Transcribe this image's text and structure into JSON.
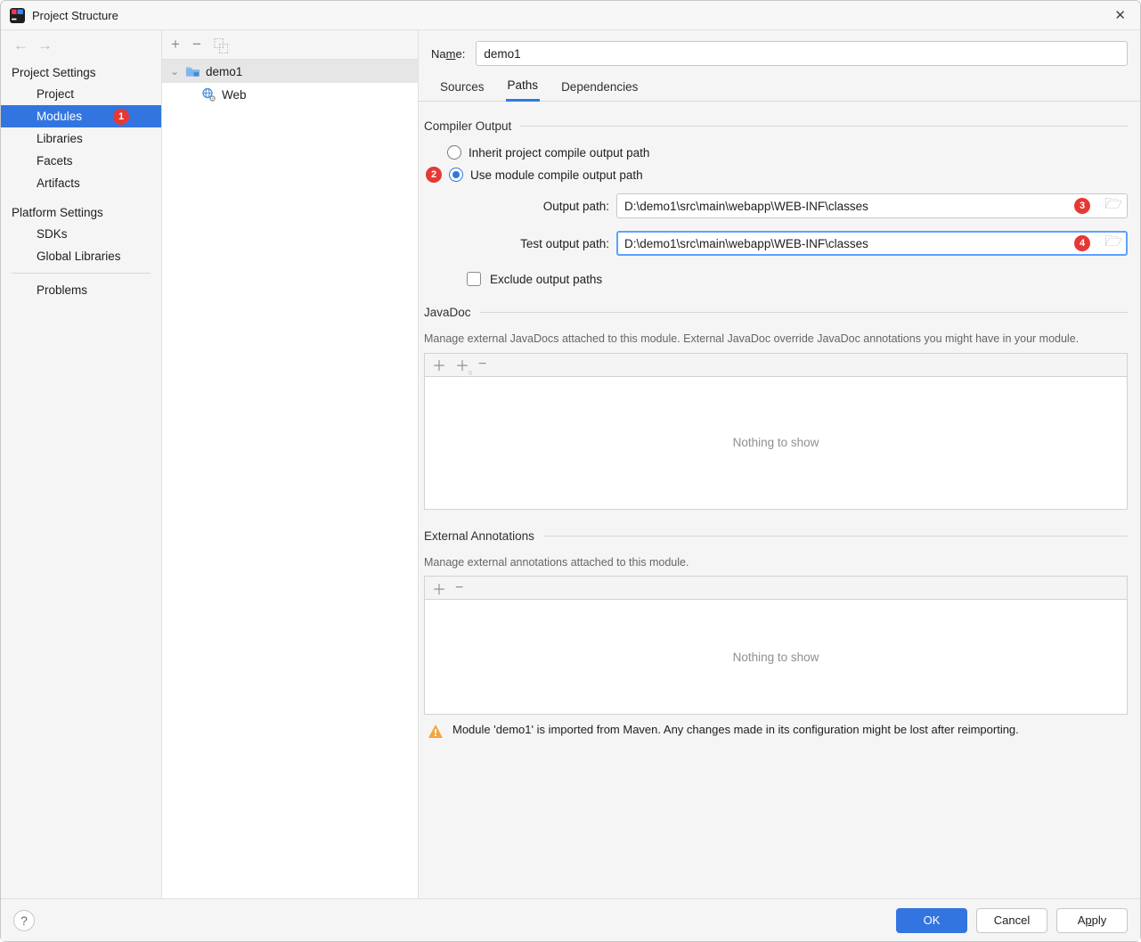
{
  "title": "Project Structure",
  "nav": {
    "section1": "Project Settings",
    "items1": [
      "Project",
      "Modules",
      "Libraries",
      "Facets",
      "Artifacts"
    ],
    "section2": "Platform Settings",
    "items2": [
      "SDKs",
      "Global Libraries"
    ],
    "problems": "Problems"
  },
  "midToolbar": {
    "add": "+",
    "remove": "−",
    "copy": "⿻"
  },
  "tree": {
    "root": "demo1",
    "child": "Web"
  },
  "right": {
    "nameLabel_a": "Na",
    "nameLabel_u": "m",
    "nameLabel_b": "e:",
    "nameValue": "demo1",
    "tabs": [
      "Sources",
      "Paths",
      "Dependencies"
    ],
    "compiler": {
      "title": "Compiler Output",
      "opt1": "Inherit project compile output path",
      "opt2": "Use module compile output path",
      "outLabel": "Output path:",
      "outValue": "D:\\demo1\\src\\main\\webapp\\WEB-INF\\classes",
      "testLabel": "Test output path:",
      "testValue": "D:\\demo1\\src\\main\\webapp\\WEB-INF\\classes",
      "exclude": "Exclude output paths"
    },
    "javadoc": {
      "title": "JavaDoc",
      "desc": "Manage external JavaDocs attached to this module. External JavaDoc override JavaDoc annotations you might have in your module.",
      "empty": "Nothing to show"
    },
    "annot": {
      "title": "External Annotations",
      "desc": "Manage external annotations attached to this module.",
      "empty": "Nothing to show"
    },
    "warning": "Module 'demo1' is imported from Maven. Any changes made in its configuration might be lost after reimporting."
  },
  "footer": {
    "ok": "OK",
    "cancel": "Cancel",
    "apply_a": "A",
    "apply_u": "p",
    "apply_b": "ply"
  },
  "annots": {
    "b1": "1",
    "b2": "2",
    "b3": "3",
    "b4": "4"
  }
}
